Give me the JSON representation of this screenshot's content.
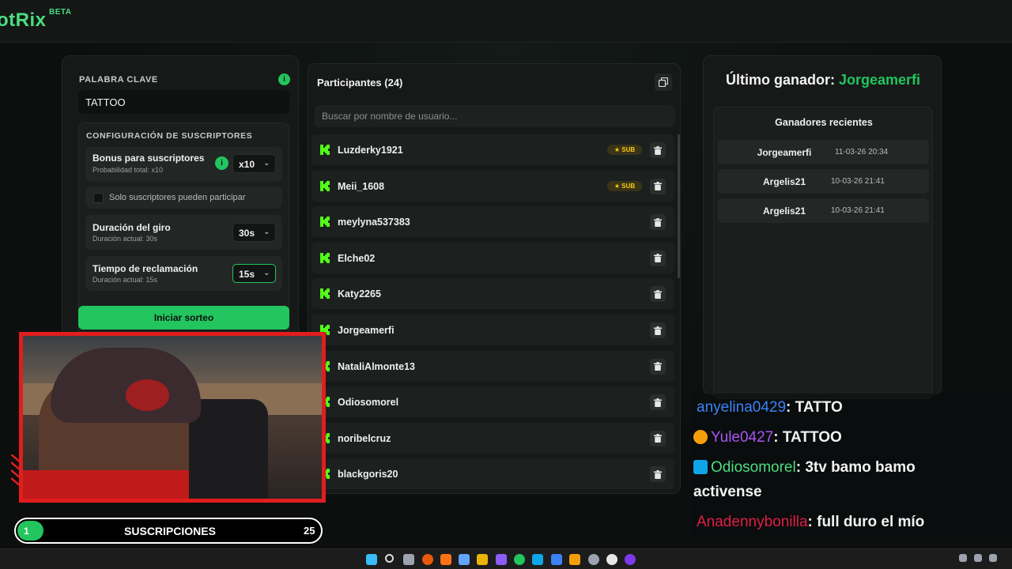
{
  "app": {
    "logo_text": "otRix",
    "beta_label": "BETA"
  },
  "config": {
    "keyword_label": "PALABRA CLAVE",
    "keyword_value": "TATTOO",
    "subs_section_title": "CONFIGURACIÓN DE SUSCRIPTORES",
    "bonus_title": "Bonus para suscriptores",
    "bonus_sub": "Probabilidad total: x10",
    "bonus_value": "x10",
    "only_subs_label": "Solo suscriptores pueden participar",
    "spin_title": "Duración del giro",
    "spin_sub": "Duración actual: 30s",
    "spin_value": "30s",
    "claim_title": "Tiempo de reclamación",
    "claim_sub": "Duración actual: 15s",
    "claim_value": "15s",
    "start_button": "Iniciar sorteo",
    "info_glyph": "i"
  },
  "participants": {
    "title": "Participantes (24)",
    "search_placeholder": "Buscar por nombre de usuario...",
    "sub_badge": "★ SUB",
    "items": [
      {
        "name": "Luzderky1921",
        "sub": true
      },
      {
        "name": "Meii_1608",
        "sub": true
      },
      {
        "name": "meylyna537383",
        "sub": false
      },
      {
        "name": "Elche02",
        "sub": false
      },
      {
        "name": "Katy2265",
        "sub": false
      },
      {
        "name": "Jorgeamerfi",
        "sub": false
      },
      {
        "name": "NataliAlmonte13",
        "sub": false
      },
      {
        "name": "Odiosomorel",
        "sub": false
      },
      {
        "name": "noribelcruz",
        "sub": false
      },
      {
        "name": "blackgoris20",
        "sub": false
      }
    ]
  },
  "winner": {
    "label": "Último ganador:",
    "name": "Jorgeamerfi",
    "recent_title": "Ganadores recientes",
    "recent": [
      {
        "name": "Jorgeamerfi",
        "date": "11-03-26 20:34"
      },
      {
        "name": "Argelis21",
        "date": "10-03-26 21:41"
      },
      {
        "name": "Argelis21",
        "date": "10-03-26 21:41"
      }
    ]
  },
  "subs_goal": {
    "current": "1",
    "label": "SUSCRIPCIONES",
    "goal": "25",
    "progress_fraction": 0.04
  },
  "chat": [
    {
      "user": "anyelina0429",
      "msg": ": TATTO",
      "color": "#3b82f6"
    },
    {
      "user": "Yule0427",
      "msg": ": TATTOO",
      "color": "#a855f7"
    },
    {
      "user": "Odiosomorel",
      "msg": ": 3tv bamo bamo",
      "msg2": "activense",
      "color": "#4ade80"
    },
    {
      "user": "Anadennybonilla",
      "msg": ": full duro el mío",
      "color": "#e11d48"
    }
  ],
  "colors": {
    "accent": "#22c55e",
    "cam_border": "#e11d1d"
  }
}
